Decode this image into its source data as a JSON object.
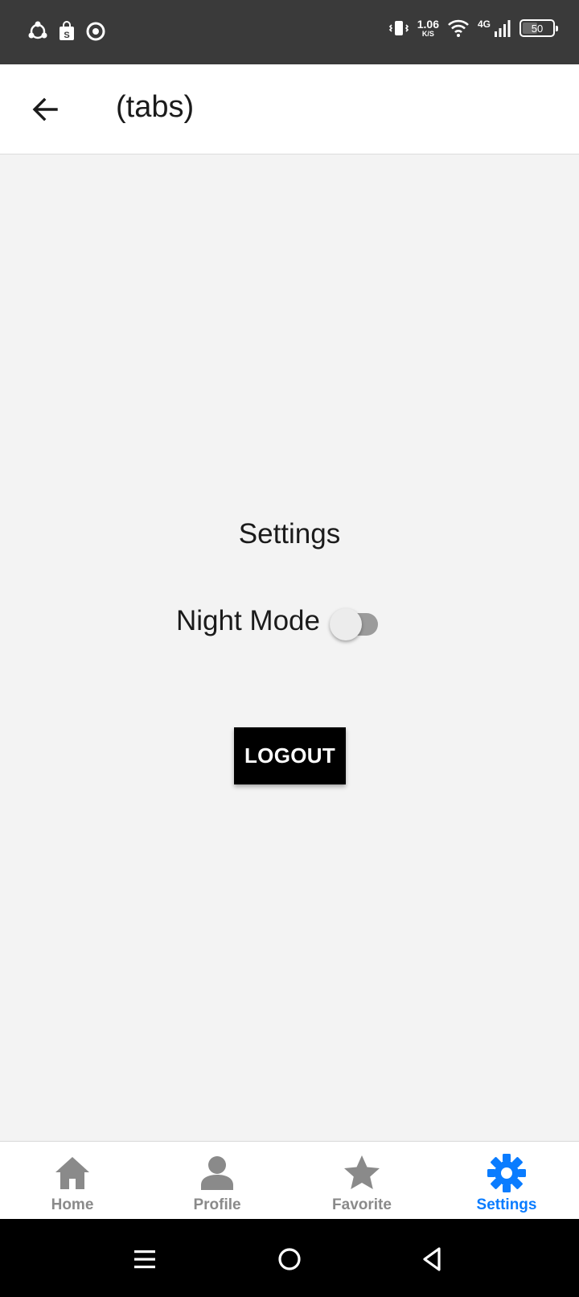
{
  "status_bar": {
    "icons_left": [
      "share-icon",
      "shop-icon",
      "chrome-icon"
    ],
    "net_speed_value": "1.06",
    "net_speed_unit": "K/S",
    "network_type": "4G",
    "battery_level": "50",
    "battery_fraction": 0.5
  },
  "header": {
    "back_icon": "arrow-left-icon",
    "title": "(tabs)"
  },
  "main": {
    "title": "Settings",
    "night_mode_label": "Night Mode",
    "night_mode_on": false,
    "logout_label": "LOGOUT"
  },
  "tabs": [
    {
      "label": "Home",
      "icon": "home-icon",
      "active": false
    },
    {
      "label": "Profile",
      "icon": "person-icon",
      "active": false
    },
    {
      "label": "Favorite",
      "icon": "star-icon",
      "active": false
    },
    {
      "label": "Settings",
      "icon": "gear-icon",
      "active": true
    }
  ],
  "colors": {
    "active_tab": "#0a7cff",
    "inactive_tab": "#8a8a8a",
    "status_bar_bg": "#3a3a3a",
    "content_bg": "#f3f3f3",
    "logout_bg": "#000000"
  },
  "nav_bar": {
    "icons": [
      "menu-icon",
      "home-circle-icon",
      "back-triangle-icon"
    ]
  }
}
